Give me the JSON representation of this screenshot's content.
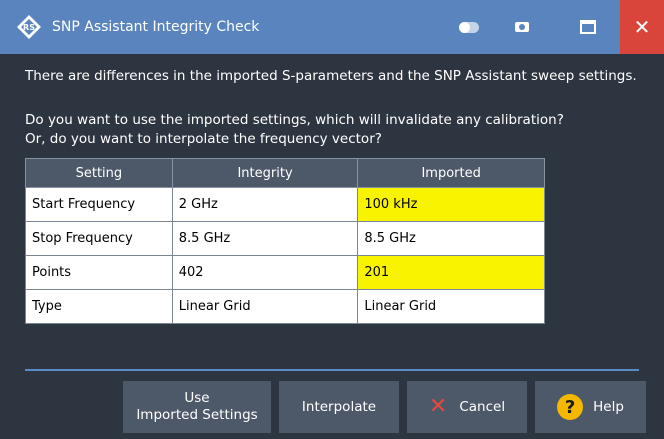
{
  "window": {
    "title": "SNP Assistant Integrity Check",
    "icons": {
      "app": "rohde-schwarz-logo-icon",
      "toggle": "toggle-icon",
      "camera": "camera-icon",
      "maximize": "maximize-icon",
      "close": "close-icon"
    },
    "close_glyph": "✕"
  },
  "message": {
    "line1": "There are differences in the imported S-parameters and the SNP Assistant sweep settings.",
    "line2": "Do you want to use the imported settings, which will invalidate any calibration?",
    "line3": "Or, do you want to interpolate the frequency vector?"
  },
  "table": {
    "headers": [
      "Setting",
      "Integrity",
      "Imported"
    ],
    "rows": [
      {
        "setting": "Start Frequency",
        "integrity": "2 GHz",
        "imported": "100 kHz",
        "differs": true
      },
      {
        "setting": "Stop Frequency",
        "integrity": "8.5 GHz",
        "imported": "8.5 GHz",
        "differs": false
      },
      {
        "setting": "Points",
        "integrity": "402",
        "imported": "201",
        "differs": true
      },
      {
        "setting": "Type",
        "integrity": "Linear Grid",
        "imported": "Linear Grid",
        "differs": false
      }
    ]
  },
  "buttons": {
    "use_line1": "Use",
    "use_line2": "Imported Settings",
    "interpolate": "Interpolate",
    "cancel": "Cancel",
    "cancel_glyph": "✕",
    "help": "Help",
    "help_glyph": "?"
  },
  "colors": {
    "titlebar": "#5a84bd",
    "close": "#d9453b",
    "background": "#2d3540",
    "highlight": "#f8f400",
    "button": "#4d5868",
    "separator": "#5b8bc6"
  }
}
